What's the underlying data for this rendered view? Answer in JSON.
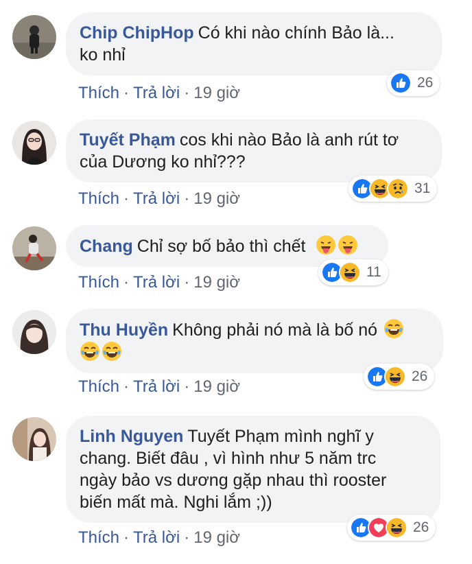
{
  "comments": [
    {
      "author": "Chip ChipHop",
      "line1": "Có khi nào chính Bảo là...",
      "line2": "ko nhỉ",
      "reaction_count": "26",
      "like_label": "Thích",
      "reply_label": "Trả lời",
      "time": "19 giờ"
    },
    {
      "author": "Tuyết Phạm",
      "line1": "cos khi nào Bảo là anh rút tơ",
      "line2": "của Dương ko nhỉ???",
      "reaction_count": "31",
      "like_label": "Thích",
      "reply_label": "Trả lời",
      "time": "19 giờ"
    },
    {
      "author": "Chang",
      "line1": "Chỉ sợ bố bảo thì chết",
      "reaction_count": "11",
      "like_label": "Thích",
      "reply_label": "Trả lời",
      "time": "19 giờ"
    },
    {
      "author": "Thu Huyền",
      "line1": "Không phải nó mà là bố nó",
      "reaction_count": "26",
      "like_label": "Thích",
      "reply_label": "Trả lời",
      "time": "19 giờ"
    },
    {
      "author": "Linh Nguyen",
      "line1": "Tuyết Phạm mình nghĩ y",
      "line2": "chang. Biết đâu , vì hình như 5 năm trc",
      "line3": "ngày bảo vs dương gặp nhau thì rooster",
      "line4": "biến mất mà. Nghi lắm ;))",
      "reaction_count": "26",
      "like_label": "Thích",
      "reply_label": "Trả lời",
      "time": "19 giờ"
    }
  ],
  "colors": {
    "author": "#385898",
    "bubble": "#f2f3f5",
    "meta": "#606770",
    "like_blue": "#1877f2",
    "love_red": "#f33e58",
    "haha_yellow": "#f7b928"
  }
}
